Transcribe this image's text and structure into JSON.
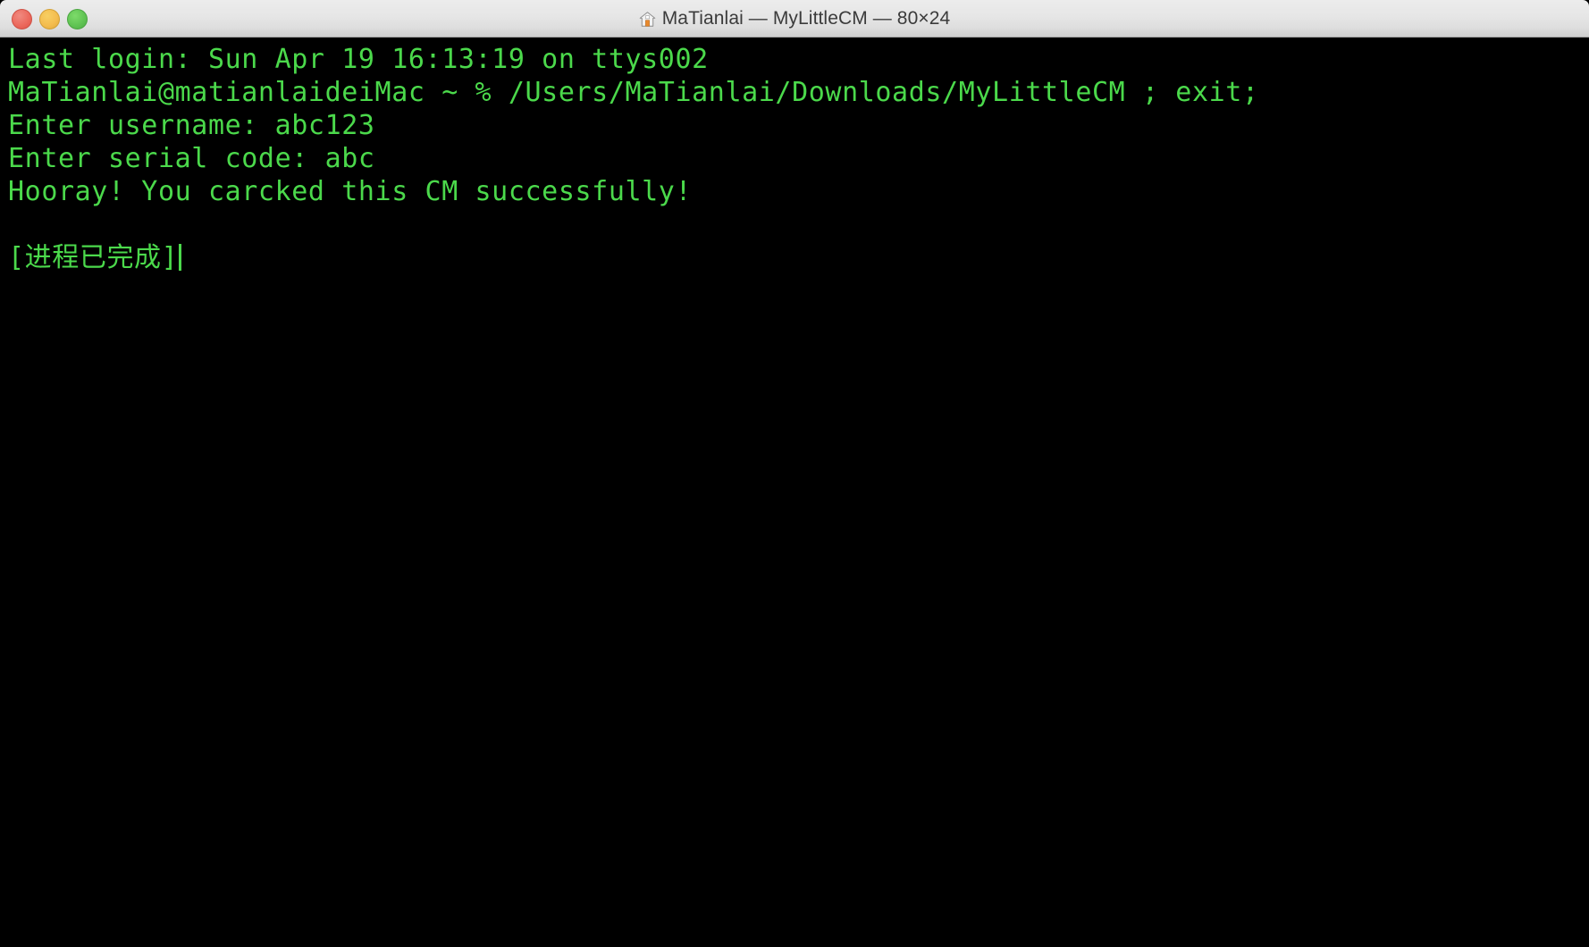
{
  "window": {
    "title": "MaTianlai — MyLittleCM — 80×24",
    "icon": "home-icon",
    "traffic_lights": [
      {
        "name": "close-button",
        "label": "Close",
        "color": "#ec6a5e"
      },
      {
        "name": "minimize-button",
        "label": "Minimize",
        "color": "#f4bd4f"
      },
      {
        "name": "zoom-button",
        "label": "Zoom",
        "color": "#61c454"
      }
    ]
  },
  "terminal": {
    "foreground_color": "#4bd94b",
    "background_color": "#000000",
    "columns": 80,
    "rows": 24,
    "cursor": "|",
    "lines": [
      "Last login: Sun Apr 19 16:13:19 on ttys002",
      "MaTianlai@matianlaideiMac ~ % /Users/MaTianlai/Downloads/MyLittleCM ; exit;",
      "Enter username: abc123",
      "Enter serial code: abc",
      "Hooray! You carcked this CM successfully!",
      "",
      "[进程已完成]"
    ]
  }
}
